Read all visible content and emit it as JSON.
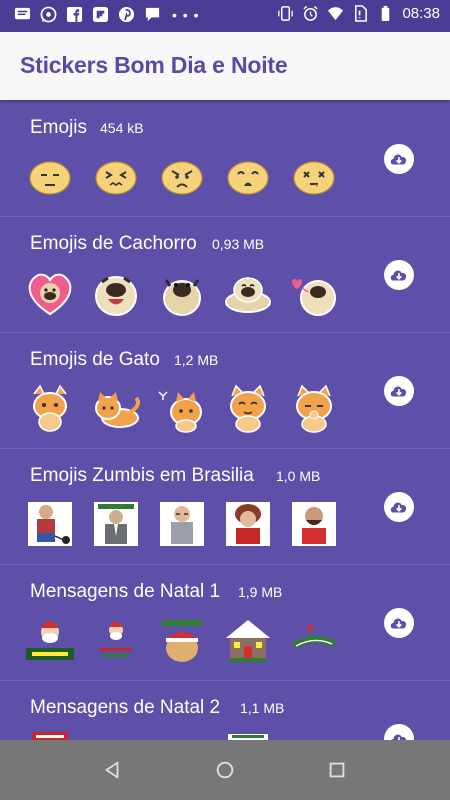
{
  "status_bar": {
    "time": "08:38",
    "left_icons": [
      "message-icon",
      "whatsapp-icon",
      "facebook-icon",
      "flipboard-icon",
      "pinterest-icon",
      "chat-icon",
      "more-dots-icon"
    ],
    "right_icons": [
      "vibrate-icon",
      "alarm-icon",
      "wifi-icon",
      "no-sim-icon",
      "battery-icon"
    ]
  },
  "app_bar": {
    "title": "Stickers Bom Dia e Noite"
  },
  "packs": [
    {
      "title": "Emojis",
      "size": "454 kB"
    },
    {
      "title": "Emojis de Cachorro",
      "size": "0,93 MB"
    },
    {
      "title": "Emojis de Gato",
      "size": "1,2 MB"
    },
    {
      "title": "Emojis Zumbis em Brasilia",
      "size": "1,0 MB"
    },
    {
      "title": "Mensagens de Natal 1",
      "size": "1,9 MB"
    },
    {
      "title": "Mensagens de Natal 2",
      "size": "1,1 MB"
    }
  ],
  "colors": {
    "background": "#5e50a9",
    "status_bar": "#4a3d95",
    "app_bar": "#f7f7f7",
    "accent": "#5b4aa5",
    "nav_bar": "#777777"
  },
  "nav_bar": {
    "icons": [
      "back-icon",
      "home-icon",
      "recents-icon"
    ]
  }
}
